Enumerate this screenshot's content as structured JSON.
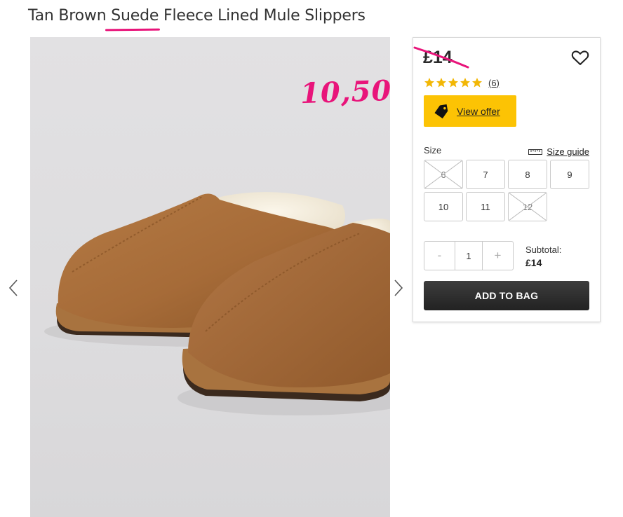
{
  "product": {
    "title_part1": "Tan Brown ",
    "title_highlight": "Suede",
    "title_part2": " Fleece Lined Mule Slippers"
  },
  "annotation": {
    "handwritten_price": "10,50",
    "color": "#e8147a"
  },
  "gallery": {
    "prev_icon": "chevron-left-icon",
    "next_icon": "chevron-right-icon"
  },
  "buy_box": {
    "price": "£14",
    "wishlist_icon": "heart-icon",
    "rating": {
      "stars": 5,
      "max_stars": 5,
      "review_count": "(6)"
    },
    "offer": {
      "label": "View offer",
      "icon": "tag-icon",
      "color": "#fcc304"
    },
    "size": {
      "label": "Size",
      "guide_label": "Size guide",
      "guide_icon": "ruler-icon",
      "options": [
        {
          "label": "6",
          "available": false
        },
        {
          "label": "7",
          "available": true
        },
        {
          "label": "8",
          "available": true
        },
        {
          "label": "9",
          "available": true
        },
        {
          "label": "10",
          "available": true
        },
        {
          "label": "11",
          "available": true
        },
        {
          "label": "12",
          "available": false
        }
      ]
    },
    "quantity": {
      "decrement": "-",
      "value": "1",
      "increment": "+"
    },
    "subtotal": {
      "label": "Subtotal:",
      "amount": "£14"
    },
    "add_to_bag": "ADD TO BAG"
  }
}
